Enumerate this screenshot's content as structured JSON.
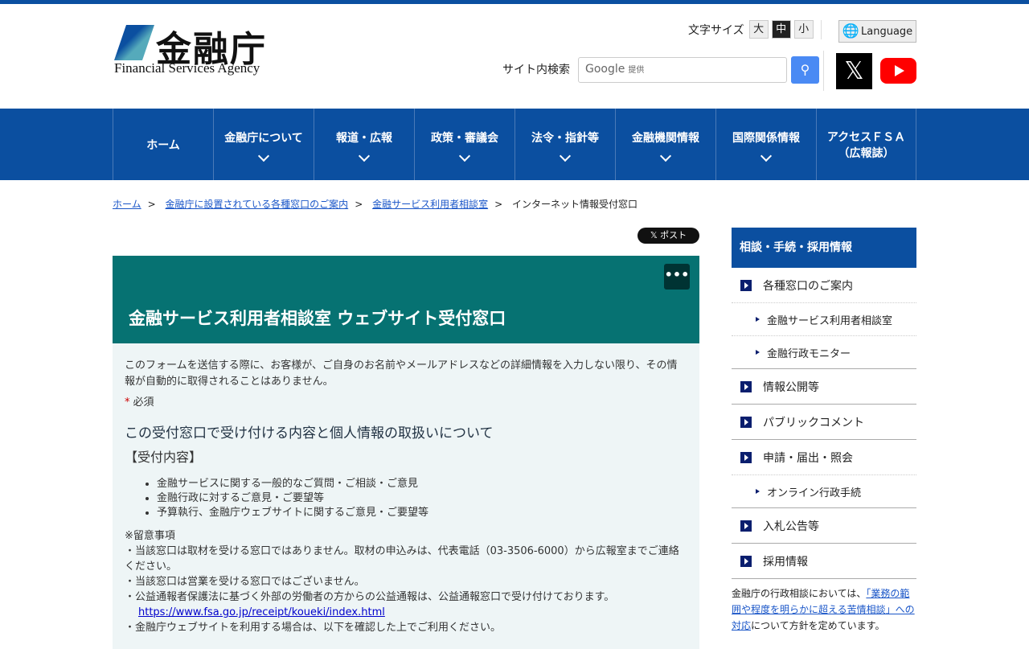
{
  "header": {
    "logo_kanji": "金融庁",
    "logo_en": "Financial Services Agency",
    "font_size_label": "文字サイズ",
    "font_sizes": [
      "大",
      "中",
      "小"
    ],
    "language": "Language",
    "search_label": "サイト内検索",
    "search_placeholder": "Google",
    "search_provided": "提供",
    "x_label": "𝕏"
  },
  "nav": [
    {
      "label": "ホーム"
    },
    {
      "label": "金融庁について"
    },
    {
      "label": "報道・広報"
    },
    {
      "label": "政策・審議会"
    },
    {
      "label": "法令・指針等"
    },
    {
      "label": "金融機関情報"
    },
    {
      "label": "国際関係情報"
    },
    {
      "label": "アクセスＦＳＡ",
      "label2": "（広報誌）"
    }
  ],
  "breadcrumb": [
    "ホーム",
    "金融庁に設置されている各種窓口のご案内",
    "金融サービス利用者相談室",
    "インターネット情報受付窓口"
  ],
  "breadcrumb_sep": ">",
  "post_button": "𝕏 ポスト",
  "main": {
    "title": "金融サービス利用者相談室 ウェブサイト受付窓口",
    "more": "•••",
    "intro": "このフォームを送信する際に、お客様が、ご自身のお名前やメールアドレスなどの詳細情報を入力しない限り、その情報が自動的に取得されることはありません。",
    "required_mark": "*",
    "required": "必須",
    "heading": "この受付窓口で受け付ける内容と個人情報の取扱いについて",
    "subheading": "【受付内容】",
    "items": [
      "金融サービスに関する一般的なご質問・ご相談・ご意見",
      "金融行政に対するご意見・ご要望等",
      "予算執行、金融庁ウェブサイトに関するご意見・ご要望等"
    ],
    "notes_title": "※留意事項",
    "notes": [
      "・当該窓口は取材を受ける窓口ではありません。取材の申込みは、代表電話（03-3506-6000）から広報室までご連絡ください。",
      "・当該窓口は営業を受ける窓口ではございません。",
      "・公益通報者保護法に基づく外部の労働者の方からの公益通報は、公益通報窓口で受け付けております。"
    ],
    "link": "https://www.fsa.go.jp/receipt/koueki/index.html",
    "note_last": "・金融庁ウェブサイトを利用する場合は、以下を確認した上でご利用ください。"
  },
  "sidebar": {
    "title": "相談・手続・採用情報",
    "items": [
      "各種窓口のご案内",
      "金融サービス利用者相談室",
      "金融行政モニター",
      "情報公開等",
      "パブリックコメント",
      "申請・届出・照会",
      "オンライン行政手続",
      "入札公告等",
      "採用情報"
    ],
    "footer_pre": "金融庁の行政相談においては、",
    "footer_link": "「業務の範囲や程度を明らかに超える苦情相談」への対応",
    "footer_post": "について方針を定めています。"
  }
}
